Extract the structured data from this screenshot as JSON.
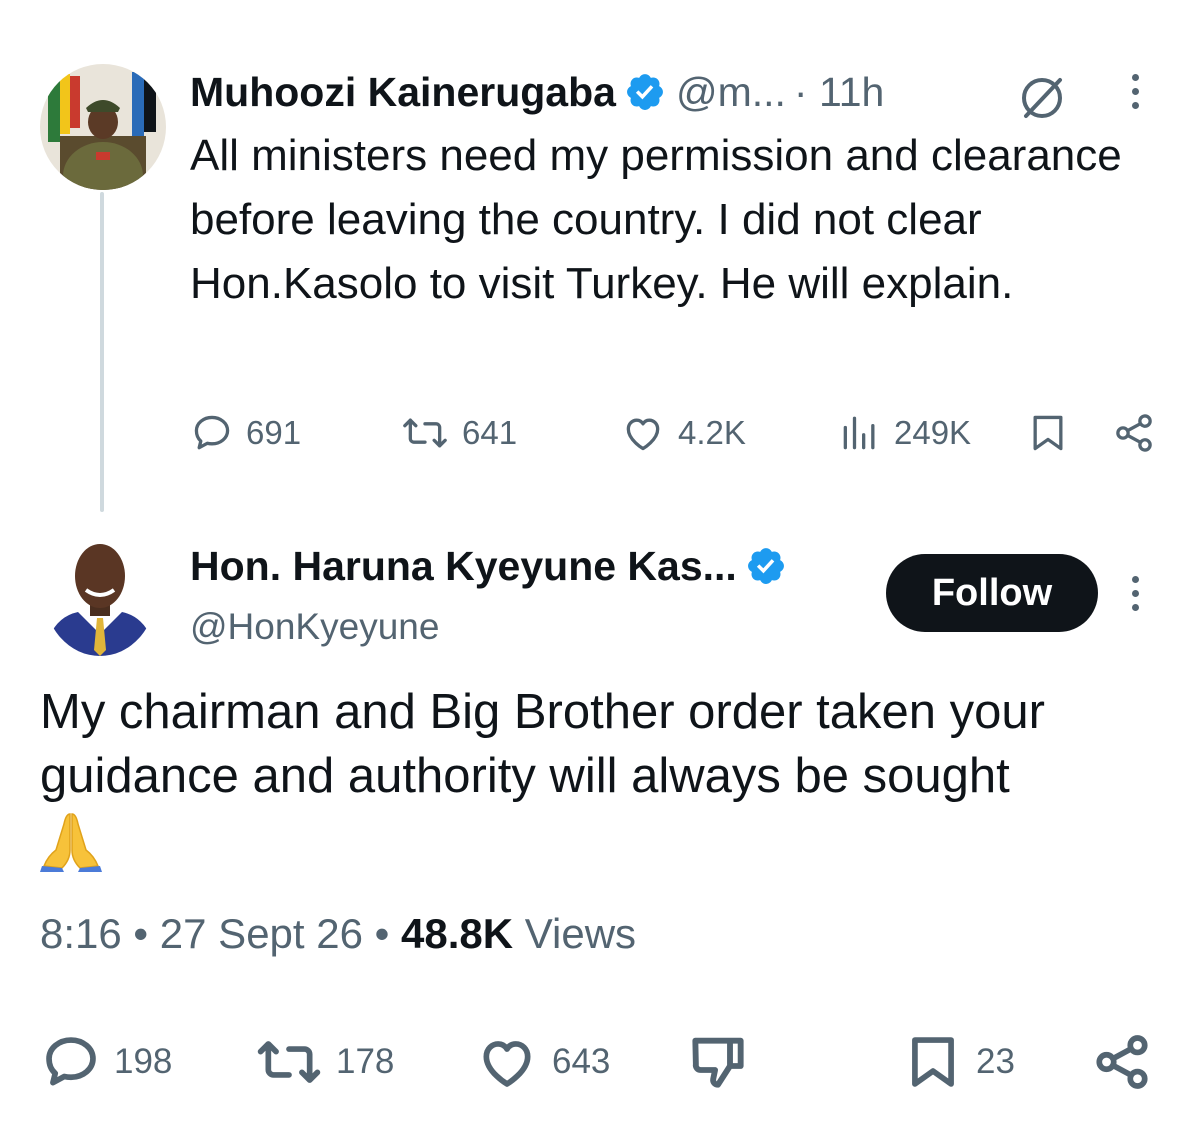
{
  "tweet1": {
    "author_name": "Muhoozi Kainerugaba",
    "handle": "@m...",
    "time": "· 11h",
    "text": "All ministers need my permission and clearance before leaving the country. I did not clear Hon.Kasolo to visit Turkey. He will explain.",
    "stats": {
      "replies": "691",
      "reposts": "641",
      "likes": "4.2K",
      "views": "249K"
    }
  },
  "tweet2": {
    "author_name": "Hon. Haruna Kyeyune Kas...",
    "handle": "@HonKyeyune",
    "follow_label": "Follow",
    "text": "My chairman and Big Brother order taken your guidance and authority will always be sought",
    "emoji": "🙏",
    "meta": {
      "time": "8:16",
      "sep1": " • ",
      "date": "27 Sept 26",
      "sep2": " • ",
      "views_count": "48.8K",
      "views_label": " Views"
    },
    "stats": {
      "replies": "198",
      "reposts": "178",
      "likes": "643",
      "bookmarks": "23"
    }
  },
  "icons": {
    "verified": "verified-badge-icon",
    "grok": "grok-icon",
    "more": "more-vertical-icon",
    "reply": "reply-icon",
    "repost": "repost-icon",
    "like": "heart-icon",
    "views": "views-icon",
    "bookmark": "bookmark-icon",
    "share": "share-icon",
    "dislike": "thumbs-down-icon"
  },
  "colors": {
    "text": "#0f1419",
    "muted": "#536471",
    "verified": "#1d9bf0",
    "thread_line": "#cfd9de",
    "follow_bg": "#0f1419"
  }
}
